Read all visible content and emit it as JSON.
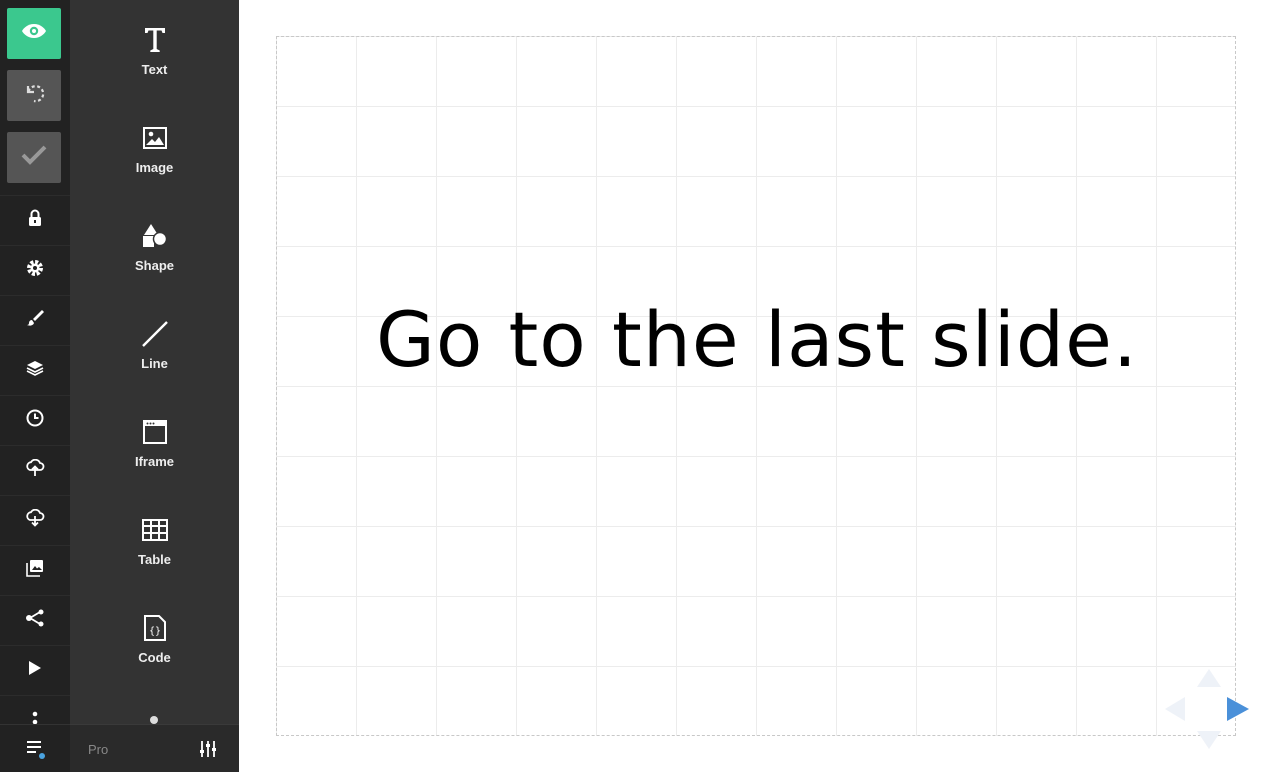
{
  "toolbar": {
    "top_buttons": [
      {
        "name": "preview",
        "icon": "eye-icon"
      },
      {
        "name": "undo",
        "icon": "undo-icon"
      },
      {
        "name": "save",
        "icon": "check-icon"
      }
    ],
    "items": [
      {
        "name": "lock",
        "icon": "lock-icon"
      },
      {
        "name": "settings",
        "icon": "gear-icon"
      },
      {
        "name": "style",
        "icon": "brush-icon"
      },
      {
        "name": "layers",
        "icon": "layers-icon"
      },
      {
        "name": "revisions",
        "icon": "clock-icon"
      },
      {
        "name": "import",
        "icon": "cloud-upload-icon"
      },
      {
        "name": "export",
        "icon": "cloud-download-icon"
      },
      {
        "name": "media",
        "icon": "image-library-icon"
      },
      {
        "name": "share",
        "icon": "share-icon"
      },
      {
        "name": "present",
        "icon": "play-icon"
      },
      {
        "name": "more",
        "icon": "more-vertical-icon"
      }
    ],
    "bottom_icon": "menu-icon",
    "accent_color": "#3bc88e"
  },
  "panel": {
    "blocks": [
      {
        "label": "Text",
        "icon": "text-icon"
      },
      {
        "label": "Image",
        "icon": "image-icon"
      },
      {
        "label": "Shape",
        "icon": "shape-icon"
      },
      {
        "label": "Line",
        "icon": "line-icon"
      },
      {
        "label": "Iframe",
        "icon": "iframe-icon"
      },
      {
        "label": "Table",
        "icon": "table-icon"
      },
      {
        "label": "Code",
        "icon": "code-icon"
      }
    ],
    "footer": {
      "pro_label": "Pro",
      "settings_icon": "sliders-icon"
    }
  },
  "slide": {
    "text": "Go to the last slide."
  },
  "navigation": {
    "arrows": [
      "up",
      "left",
      "right",
      "down"
    ],
    "active_color": "#4a90d9"
  }
}
